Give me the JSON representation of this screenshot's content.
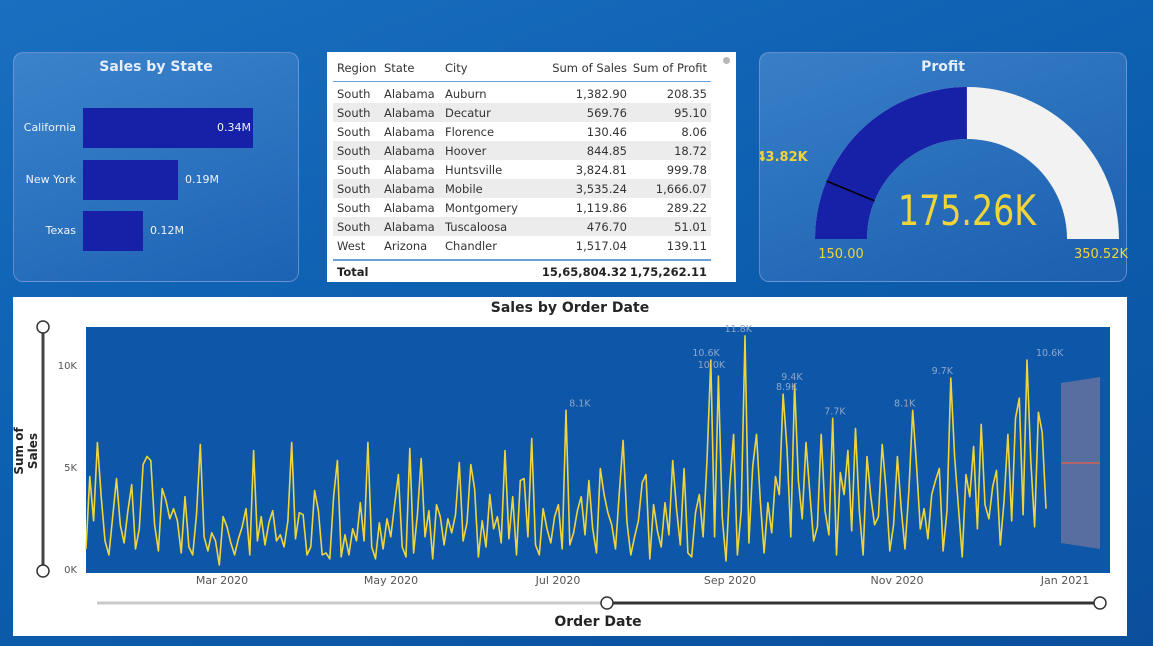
{
  "sales_by_state": {
    "title": "Sales by State",
    "chart_data": {
      "type": "bar",
      "orientation": "horizontal",
      "title": "Sales by State",
      "categories": [
        "California",
        "New York",
        "Texas"
      ],
      "values": [
        340000,
        190000,
        120000
      ],
      "value_labels": [
        "0.34M",
        "0.19M",
        "0.12M"
      ],
      "color": "#1621a8"
    }
  },
  "table": {
    "columns": [
      "Region",
      "State",
      "City",
      "Sum of Sales",
      "Sum of Profit"
    ],
    "rows": [
      [
        "South",
        "Alabama",
        "Auburn",
        "1,382.90",
        "208.35"
      ],
      [
        "South",
        "Alabama",
        "Decatur",
        "569.76",
        "95.10"
      ],
      [
        "South",
        "Alabama",
        "Florence",
        "130.46",
        "8.06"
      ],
      [
        "South",
        "Alabama",
        "Hoover",
        "844.85",
        "18.72"
      ],
      [
        "South",
        "Alabama",
        "Huntsville",
        "3,824.81",
        "999.78"
      ],
      [
        "South",
        "Alabama",
        "Mobile",
        "3,535.24",
        "1,666.07"
      ],
      [
        "South",
        "Alabama",
        "Montgomery",
        "1,119.86",
        "289.22"
      ],
      [
        "South",
        "Alabama",
        "Tuscaloosa",
        "476.70",
        "51.01"
      ],
      [
        "West",
        "Arizona",
        "Chandler",
        "1,517.04",
        "139.11"
      ]
    ],
    "total": {
      "label": "Total",
      "sales": "15,65,804.32",
      "profit": "1,75,262.11"
    }
  },
  "profit": {
    "title": "Profit",
    "value_label": "175.26K",
    "value": 175260,
    "min_label": "150.00",
    "min": 150,
    "max_label": "350.52K",
    "max": 350520,
    "target_label": "43.82K",
    "target": 43820,
    "colors": {
      "fill": "#1621a8",
      "track": "#f2f2f2",
      "text": "#f0d53a"
    }
  },
  "sales_by_order_date": {
    "title": "Sales by Order Date",
    "xlabel": "Order Date",
    "ylabel": "Sum of Sales",
    "yticks": [
      "0K",
      "5K",
      "10K"
    ],
    "xticks": [
      "Mar 2020",
      "May 2020",
      "Jul 2020",
      "Sep 2020",
      "Nov 2020",
      "Jan 2021"
    ],
    "chart_data": {
      "type": "line",
      "title": "Sales by Order Date",
      "xlabel": "Order Date",
      "ylabel": "Sum of Sales",
      "ylim": [
        0,
        12000
      ],
      "x_start": "2020-01-01",
      "x_end": "2021-01-12",
      "line_color": "#f0d53a",
      "background": "#0d56a8",
      "peak_labels": [
        {
          "date": "2020-07-03",
          "value": 8100,
          "label": "8.1K"
        },
        {
          "date": "2020-08-19",
          "value": 10600,
          "label": "10.6K"
        },
        {
          "date": "2020-08-21",
          "value": 10000,
          "label": "10.0K"
        },
        {
          "date": "2020-08-31",
          "value": 11800,
          "label": "11.8K"
        },
        {
          "date": "2020-09-18",
          "value": 8900,
          "label": "8.9K"
        },
        {
          "date": "2020-09-20",
          "value": 9400,
          "label": "9.4K"
        },
        {
          "date": "2020-10-06",
          "value": 7700,
          "label": "7.7K"
        },
        {
          "date": "2020-11-01",
          "value": 8100,
          "label": "8.1K"
        },
        {
          "date": "2020-11-15",
          "value": 9700,
          "label": "9.7K"
        },
        {
          "date": "2020-12-25",
          "value": 10600,
          "label": "10.6K"
        }
      ],
      "values": [
        1200,
        4800,
        2600,
        6500,
        3800,
        1600,
        900,
        2800,
        4700,
        2400,
        1500,
        3100,
        4400,
        1200,
        2200,
        5400,
        5800,
        5600,
        2400,
        1100,
        4200,
        3600,
        2700,
        3200,
        2600,
        1000,
        3800,
        1300,
        900,
        2900,
        6400,
        1800,
        1100,
        2000,
        1600,
        400,
        2800,
        2300,
        1500,
        900,
        1700,
        2300,
        3200,
        900,
        6100,
        1600,
        2800,
        1400,
        2500,
        3100,
        1600,
        1900,
        1300,
        2600,
        6500,
        1700,
        3000,
        2900,
        900,
        1300,
        4100,
        3100,
        900,
        1000,
        700,
        3800,
        5600,
        800,
        1900,
        900,
        2200,
        1600,
        3500,
        1600,
        6500,
        1300,
        700,
        2500,
        1200,
        2700,
        1800,
        3400,
        4900,
        1300,
        800,
        6200,
        1000,
        2900,
        5700,
        1800,
        3100,
        700,
        3400,
        2800,
        1400,
        2700,
        2000,
        2900,
        5500,
        1600,
        2500,
        5400,
        4200,
        800,
        2600,
        1300,
        3900,
        2200,
        2800,
        1500,
        6100,
        1700,
        3800,
        900,
        4600,
        4700,
        1800,
        6700,
        1400,
        900,
        3200,
        2200,
        1500,
        2800,
        3400,
        1200,
        8100,
        1400,
        2000,
        3100,
        3800,
        1900,
        4600,
        2200,
        1000,
        5200,
        3900,
        3000,
        2400,
        1200,
        4000,
        6600,
        2500,
        900,
        1800,
        2600,
        4500,
        4900,
        700,
        3400,
        2100,
        1300,
        3500,
        1900,
        5600,
        3200,
        1400,
        5200,
        1000,
        800,
        3000,
        3900,
        1800,
        5600,
        10600,
        1800,
        9800,
        2800,
        600,
        4400,
        6900,
        900,
        3100,
        11800,
        1500,
        5300,
        6900,
        3600,
        1000,
        3500,
        2000,
        4800,
        3900,
        8900,
        6200,
        1800,
        9400,
        4600,
        2700,
        6500,
        4000,
        1600,
        2300,
        6900,
        3100,
        1900,
        7700,
        900,
        5000,
        3900,
        6100,
        2100,
        7200,
        3100,
        900,
        5800,
        3800,
        2400,
        2800,
        6400,
        4200,
        1100,
        2400,
        5800,
        3200,
        1200,
        4100,
        8100,
        5400,
        2200,
        3200,
        1700,
        3900,
        4600,
        5200,
        1100,
        3100,
        9700,
        5800,
        3300,
        800,
        4900,
        3800,
        6300,
        2200,
        7400,
        3400,
        2700,
        4300,
        5100,
        1400,
        3600,
        6900,
        2600,
        7700,
        8700,
        2900,
        10600,
        5600,
        2300,
        8000,
        7000,
        3200
      ]
    }
  }
}
